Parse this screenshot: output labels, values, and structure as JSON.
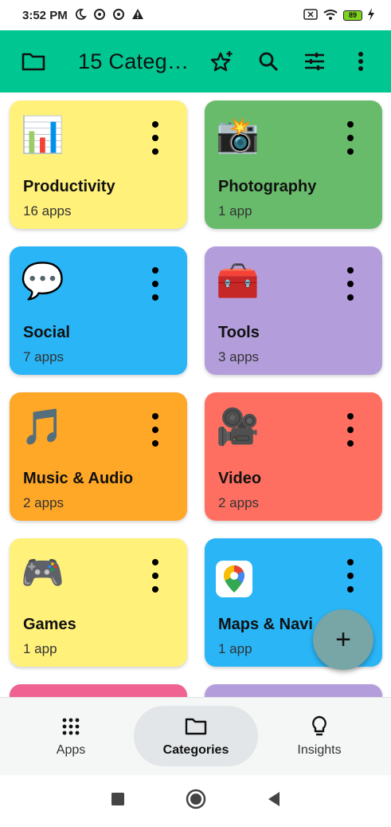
{
  "status_bar": {
    "time": "3:52 PM",
    "icons_left": [
      "moon-icon",
      "data-saver-icon",
      "data-saver-icon",
      "warning-icon"
    ],
    "icons_right": [
      "sim-off-icon",
      "wifi-icon",
      "battery-icon",
      "charging-icon"
    ],
    "battery": "89"
  },
  "app_bar": {
    "title": "15 Categ…",
    "background": "#00c691",
    "actions": [
      "folder-icon",
      "star-add-icon",
      "search-icon",
      "filter-icon",
      "more-vert-icon"
    ]
  },
  "categories": [
    {
      "name": "Productivity",
      "count": "16 apps",
      "color": "#fff17a",
      "icon": "bar-chart-icon",
      "glyph": "📊"
    },
    {
      "name": "Photography",
      "count": "1 app",
      "color": "#68bb6b",
      "icon": "camera-flash-icon",
      "glyph": "📸"
    },
    {
      "name": "Social",
      "count": "7 apps",
      "color": "#29b5f6",
      "icon": "speech-bubble-icon",
      "glyph": "💬"
    },
    {
      "name": "Tools",
      "count": "3 apps",
      "color": "#b39ddb",
      "icon": "toolbox-icon",
      "glyph": "🧰"
    },
    {
      "name": "Music & Audio",
      "count": "2 apps",
      "color": "#ffa726",
      "icon": "music-note-icon",
      "glyph": "🎵"
    },
    {
      "name": "Video",
      "count": "2 apps",
      "color": "#ff6f61",
      "icon": "movie-camera-icon",
      "glyph": "🎥"
    },
    {
      "name": "Games",
      "count": "1 app",
      "color": "#fff17a",
      "icon": "game-controller-icon",
      "glyph": "🎮"
    },
    {
      "name": "Maps & Navi",
      "count": "1 app",
      "color": "#29b5f6",
      "icon": "google-maps-icon",
      "glyph": ""
    }
  ],
  "peek_colors": [
    "#f06292",
    "#b39ddb"
  ],
  "fab": {
    "glyph": "+"
  },
  "bottom_nav": {
    "items": [
      {
        "label": "Apps",
        "icon": "apps-grid-icon",
        "active": false
      },
      {
        "label": "Categories",
        "icon": "folder-icon",
        "active": true
      },
      {
        "label": "Insights",
        "icon": "lightbulb-icon",
        "active": false
      }
    ]
  },
  "system_nav": [
    "recents-square-icon",
    "home-circle-icon",
    "back-triangle-icon"
  ]
}
